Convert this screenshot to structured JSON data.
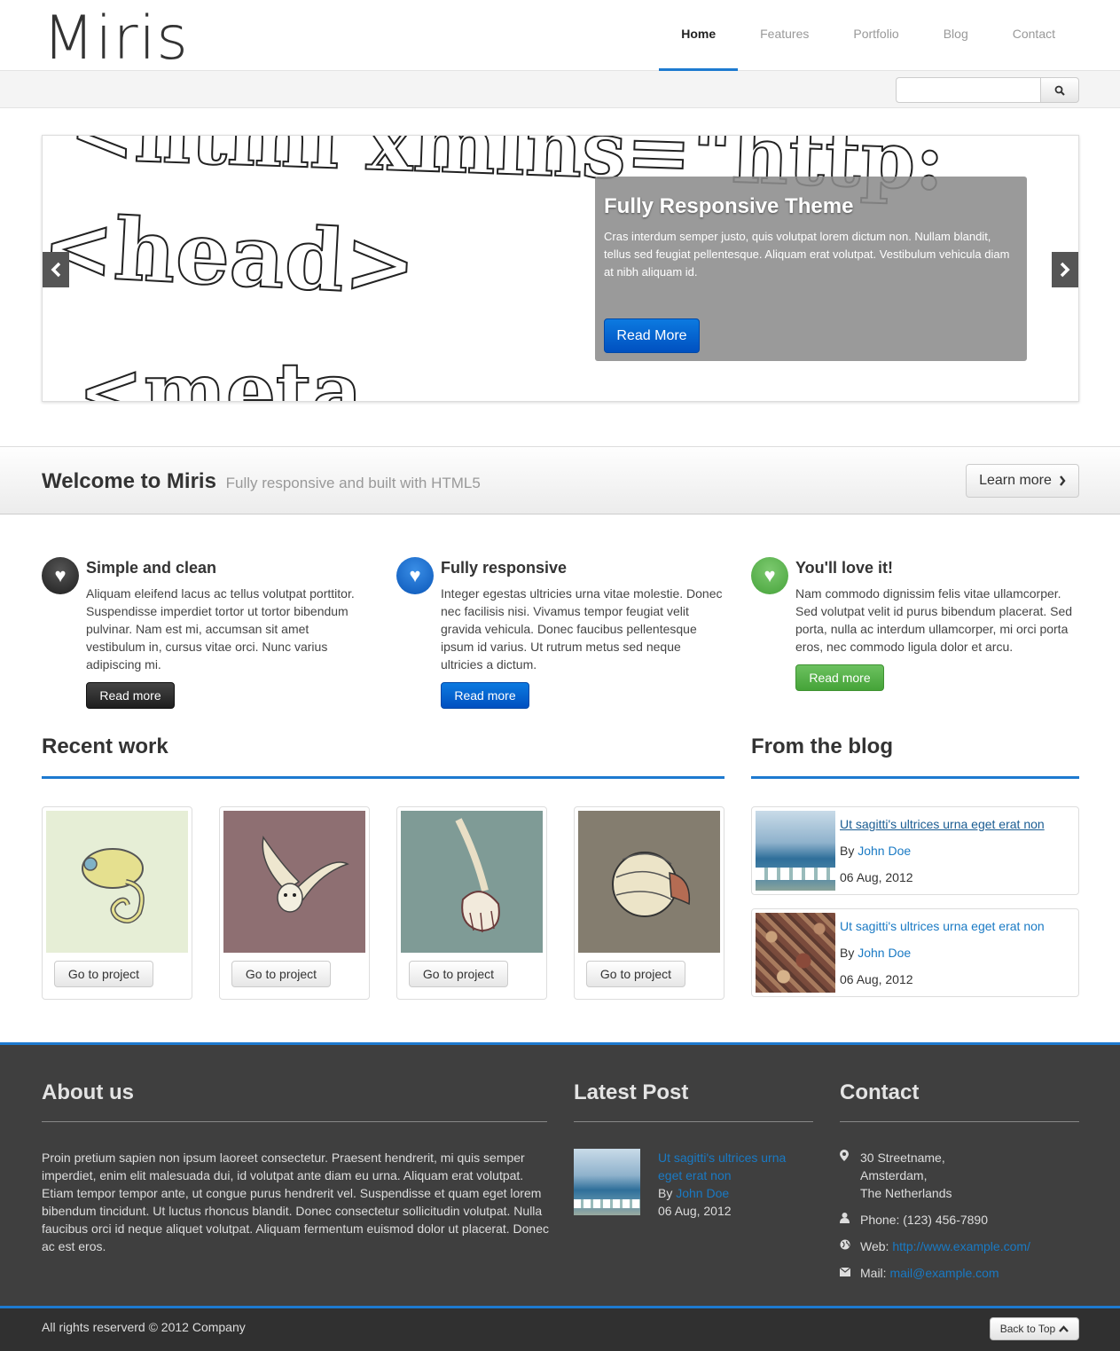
{
  "header": {
    "logo": "Miris",
    "nav": [
      "Home",
      "Features",
      "Portfolio",
      "Blog",
      "Contact"
    ]
  },
  "search": {
    "placeholder": ""
  },
  "slider": {
    "title": "Fully Responsive Theme",
    "text": "Cras interdum semper justo, quis volutpat lorem dictum non. Nullam blandit, tellus sed feugiat pellentesque. Aliquam erat volutpat. Vestibulum vehicula diam at nibh aliquam id.",
    "button": "Read More",
    "bg_lines": [
      "<html xmlns=\"http:",
      "<head>",
      "<meta"
    ]
  },
  "welcome": {
    "title": "Welcome to Miris",
    "subtitle": "Fully responsive and built with HTML5",
    "button": "Learn more"
  },
  "features": [
    {
      "title": "Simple and clean",
      "text": "Aliquam eleifend lacus ac tellus volutpat porttitor. Suspendisse imperdiet tortor ut tortor bibendum pulvinar. Nam est mi, accumsan sit amet vestibulum in, cursus vitae orci. Nunc varius adipiscing mi.",
      "button": "Read more",
      "color": "#2b2b2b"
    },
    {
      "title": "Fully responsive",
      "text": "Integer egestas ultricies urna vitae molestie. Donec nec facilisis nisi. Vivamus tempor feugiat velit gravida vehicula. Donec faucibus pellentesque ipsum id varius. Ut rutrum metus sed neque ultricies a dictum.",
      "button": "Read more",
      "color": "#0a63c9"
    },
    {
      "title": "You'll love it!",
      "text": "Nam commodo dignissim felis vitae ullamcorper. Sed volutpat velit id purus bibendum placerat. Sed porta, nulla ac interdum ullamcorper, mi orci porta eros, nec commodo ligula dolor et arcu.",
      "button": "Read more",
      "color": "#55ad4a"
    }
  ],
  "recent_work": {
    "title": "Recent work",
    "items": [
      {
        "button": "Go to project",
        "bg": "#e6eed6"
      },
      {
        "button": "Go to project",
        "bg": "#8e6f72"
      },
      {
        "button": "Go to project",
        "bg": "#7f9b96"
      },
      {
        "button": "Go to project",
        "bg": "#847d6f"
      }
    ]
  },
  "blog": {
    "title": "From the blog",
    "posts": [
      {
        "title": "Ut sagitti's ultrices urna eget erat non",
        "by": "By ",
        "author": "John Doe",
        "date": "06 Aug, 2012"
      },
      {
        "title": "Ut sagitti's ultrices urna eget erat non",
        "by": "By ",
        "author": "John Doe",
        "date": "06 Aug, 2012"
      }
    ]
  },
  "footer": {
    "about_title": "About us",
    "about_text": "Proin pretium sapien non ipsum laoreet consectetur. Praesent hendrerit, mi quis semper imperdiet, enim elit malesuada dui, id volutpat ante diam eu urna. Aliquam erat volutpat. Etiam tempor tempor ante, ut congue purus hendrerit vel. Suspendisse et quam eget lorem bibendum tincidunt. Ut luctus rhoncus blandit. Donec consectetur sollicitudin volutpat. Nulla faucibus orci id neque aliquet volutpat. Aliquam fermentum euismod dolor ut placerat. Donec ac est eros.",
    "latest_title": "Latest Post",
    "latest": {
      "title_1": "Ut sagitti's ultrices urna",
      "title_2": "eget erat non",
      "by": "By ",
      "author": "John Doe",
      "date": "06 Aug, 2012"
    },
    "contact_title": "Contact",
    "address": [
      "30 Streetname,",
      "Amsterdam,",
      "The Netherlands"
    ],
    "phone": "Phone: (123) 456-7890",
    "web_label": "Web: ",
    "web": "http://www.example.com/",
    "mail_label": "Mail: ",
    "mail": "mail@example.com",
    "copyright": "All rights reserverd © 2012 Company",
    "back_to_top": "Back to Top"
  }
}
